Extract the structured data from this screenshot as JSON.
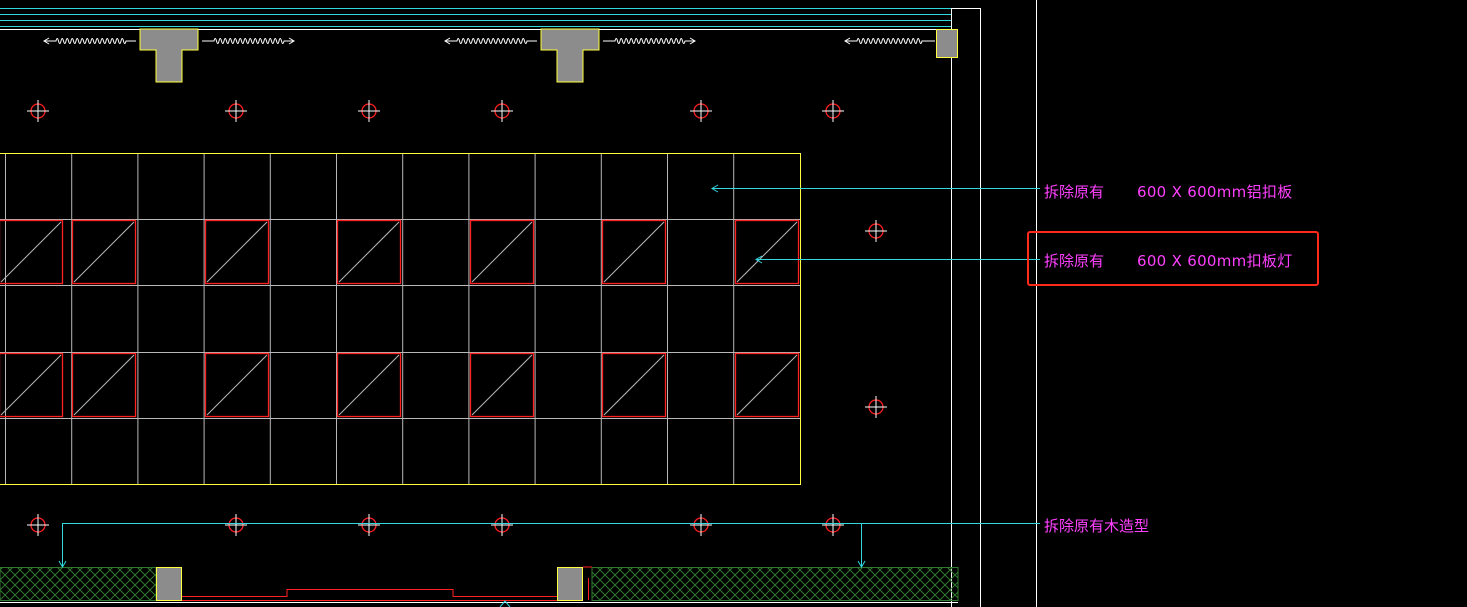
{
  "annotations": {
    "aluminum_panel": {
      "prefix": "拆除原有",
      "spec": "600 X 600mm铝扣板"
    },
    "panel_light": {
      "prefix": "拆除原有",
      "spec": "600 X 600mm扣板灯"
    },
    "wood_feature": {
      "text": "拆除原有木造型"
    }
  },
  "colors": {
    "background": "#000000",
    "ceiling_outline": "#ffff40",
    "grid_line": "#b8b8b8",
    "light_fixture": "#ff2020",
    "leader_line": "#30d8e0",
    "annotation_text": "#ff40ff",
    "wall_line": "#ffffff",
    "beam_fill": "#8c8c8c",
    "hatch": "#2f7a2f",
    "highlight_box": "#ff2a1a"
  },
  "icons": {
    "downlight": "downlight-crosshair-icon",
    "ac_vent": "ac-vent-icon"
  }
}
